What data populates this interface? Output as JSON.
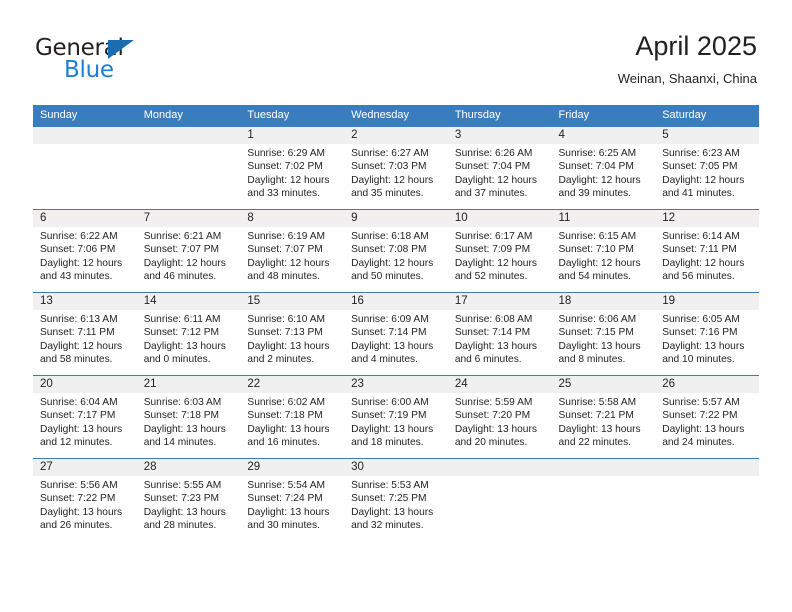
{
  "brand": {
    "name_top": "General",
    "name_bottom": "Blue",
    "triangle_color": "#1b6cb0",
    "blue_color": "#1b7fd4"
  },
  "header": {
    "title": "April 2025",
    "subtitle": "Weinan, Shaanxi, China"
  },
  "theme": {
    "header_blue": "#3a7dbf",
    "band_gray": "#f0f0f0",
    "text": "#231f20"
  },
  "weekday_headers": [
    "Sunday",
    "Monday",
    "Tuesday",
    "Wednesday",
    "Thursday",
    "Friday",
    "Saturday"
  ],
  "labels": {
    "sunrise_prefix": "Sunrise:",
    "sunset_prefix": "Sunset:",
    "daylight_prefix": "Daylight:"
  },
  "weeks": [
    [
      {
        "day": "",
        "empty": true
      },
      {
        "day": "",
        "empty": true
      },
      {
        "day": "1",
        "sunrise": "Sunrise: 6:29 AM",
        "sunset": "Sunset: 7:02 PM",
        "daylight_line1": "Daylight: 12 hours",
        "daylight_line2": "and 33 minutes."
      },
      {
        "day": "2",
        "sunrise": "Sunrise: 6:27 AM",
        "sunset": "Sunset: 7:03 PM",
        "daylight_line1": "Daylight: 12 hours",
        "daylight_line2": "and 35 minutes."
      },
      {
        "day": "3",
        "sunrise": "Sunrise: 6:26 AM",
        "sunset": "Sunset: 7:04 PM",
        "daylight_line1": "Daylight: 12 hours",
        "daylight_line2": "and 37 minutes."
      },
      {
        "day": "4",
        "sunrise": "Sunrise: 6:25 AM",
        "sunset": "Sunset: 7:04 PM",
        "daylight_line1": "Daylight: 12 hours",
        "daylight_line2": "and 39 minutes."
      },
      {
        "day": "5",
        "sunrise": "Sunrise: 6:23 AM",
        "sunset": "Sunset: 7:05 PM",
        "daylight_line1": "Daylight: 12 hours",
        "daylight_line2": "and 41 minutes."
      }
    ],
    [
      {
        "day": "6",
        "sunrise": "Sunrise: 6:22 AM",
        "sunset": "Sunset: 7:06 PM",
        "daylight_line1": "Daylight: 12 hours",
        "daylight_line2": "and 43 minutes."
      },
      {
        "day": "7",
        "sunrise": "Sunrise: 6:21 AM",
        "sunset": "Sunset: 7:07 PM",
        "daylight_line1": "Daylight: 12 hours",
        "daylight_line2": "and 46 minutes."
      },
      {
        "day": "8",
        "sunrise": "Sunrise: 6:19 AM",
        "sunset": "Sunset: 7:07 PM",
        "daylight_line1": "Daylight: 12 hours",
        "daylight_line2": "and 48 minutes."
      },
      {
        "day": "9",
        "sunrise": "Sunrise: 6:18 AM",
        "sunset": "Sunset: 7:08 PM",
        "daylight_line1": "Daylight: 12 hours",
        "daylight_line2": "and 50 minutes."
      },
      {
        "day": "10",
        "sunrise": "Sunrise: 6:17 AM",
        "sunset": "Sunset: 7:09 PM",
        "daylight_line1": "Daylight: 12 hours",
        "daylight_line2": "and 52 minutes."
      },
      {
        "day": "11",
        "sunrise": "Sunrise: 6:15 AM",
        "sunset": "Sunset: 7:10 PM",
        "daylight_line1": "Daylight: 12 hours",
        "daylight_line2": "and 54 minutes."
      },
      {
        "day": "12",
        "sunrise": "Sunrise: 6:14 AM",
        "sunset": "Sunset: 7:11 PM",
        "daylight_line1": "Daylight: 12 hours",
        "daylight_line2": "and 56 minutes."
      }
    ],
    [
      {
        "day": "13",
        "sunrise": "Sunrise: 6:13 AM",
        "sunset": "Sunset: 7:11 PM",
        "daylight_line1": "Daylight: 12 hours",
        "daylight_line2": "and 58 minutes."
      },
      {
        "day": "14",
        "sunrise": "Sunrise: 6:11 AM",
        "sunset": "Sunset: 7:12 PM",
        "daylight_line1": "Daylight: 13 hours",
        "daylight_line2": "and 0 minutes."
      },
      {
        "day": "15",
        "sunrise": "Sunrise: 6:10 AM",
        "sunset": "Sunset: 7:13 PM",
        "daylight_line1": "Daylight: 13 hours",
        "daylight_line2": "and 2 minutes."
      },
      {
        "day": "16",
        "sunrise": "Sunrise: 6:09 AM",
        "sunset": "Sunset: 7:14 PM",
        "daylight_line1": "Daylight: 13 hours",
        "daylight_line2": "and 4 minutes."
      },
      {
        "day": "17",
        "sunrise": "Sunrise: 6:08 AM",
        "sunset": "Sunset: 7:14 PM",
        "daylight_line1": "Daylight: 13 hours",
        "daylight_line2": "and 6 minutes."
      },
      {
        "day": "18",
        "sunrise": "Sunrise: 6:06 AM",
        "sunset": "Sunset: 7:15 PM",
        "daylight_line1": "Daylight: 13 hours",
        "daylight_line2": "and 8 minutes."
      },
      {
        "day": "19",
        "sunrise": "Sunrise: 6:05 AM",
        "sunset": "Sunset: 7:16 PM",
        "daylight_line1": "Daylight: 13 hours",
        "daylight_line2": "and 10 minutes."
      }
    ],
    [
      {
        "day": "20",
        "sunrise": "Sunrise: 6:04 AM",
        "sunset": "Sunset: 7:17 PM",
        "daylight_line1": "Daylight: 13 hours",
        "daylight_line2": "and 12 minutes."
      },
      {
        "day": "21",
        "sunrise": "Sunrise: 6:03 AM",
        "sunset": "Sunset: 7:18 PM",
        "daylight_line1": "Daylight: 13 hours",
        "daylight_line2": "and 14 minutes."
      },
      {
        "day": "22",
        "sunrise": "Sunrise: 6:02 AM",
        "sunset": "Sunset: 7:18 PM",
        "daylight_line1": "Daylight: 13 hours",
        "daylight_line2": "and 16 minutes."
      },
      {
        "day": "23",
        "sunrise": "Sunrise: 6:00 AM",
        "sunset": "Sunset: 7:19 PM",
        "daylight_line1": "Daylight: 13 hours",
        "daylight_line2": "and 18 minutes."
      },
      {
        "day": "24",
        "sunrise": "Sunrise: 5:59 AM",
        "sunset": "Sunset: 7:20 PM",
        "daylight_line1": "Daylight: 13 hours",
        "daylight_line2": "and 20 minutes."
      },
      {
        "day": "25",
        "sunrise": "Sunrise: 5:58 AM",
        "sunset": "Sunset: 7:21 PM",
        "daylight_line1": "Daylight: 13 hours",
        "daylight_line2": "and 22 minutes."
      },
      {
        "day": "26",
        "sunrise": "Sunrise: 5:57 AM",
        "sunset": "Sunset: 7:22 PM",
        "daylight_line1": "Daylight: 13 hours",
        "daylight_line2": "and 24 minutes."
      }
    ],
    [
      {
        "day": "27",
        "sunrise": "Sunrise: 5:56 AM",
        "sunset": "Sunset: 7:22 PM",
        "daylight_line1": "Daylight: 13 hours",
        "daylight_line2": "and 26 minutes."
      },
      {
        "day": "28",
        "sunrise": "Sunrise: 5:55 AM",
        "sunset": "Sunset: 7:23 PM",
        "daylight_line1": "Daylight: 13 hours",
        "daylight_line2": "and 28 minutes."
      },
      {
        "day": "29",
        "sunrise": "Sunrise: 5:54 AM",
        "sunset": "Sunset: 7:24 PM",
        "daylight_line1": "Daylight: 13 hours",
        "daylight_line2": "and 30 minutes."
      },
      {
        "day": "30",
        "sunrise": "Sunrise: 5:53 AM",
        "sunset": "Sunset: 7:25 PM",
        "daylight_line1": "Daylight: 13 hours",
        "daylight_line2": "and 32 minutes."
      },
      {
        "day": "",
        "empty": true
      },
      {
        "day": "",
        "empty": true
      },
      {
        "day": "",
        "empty": true
      }
    ]
  ]
}
